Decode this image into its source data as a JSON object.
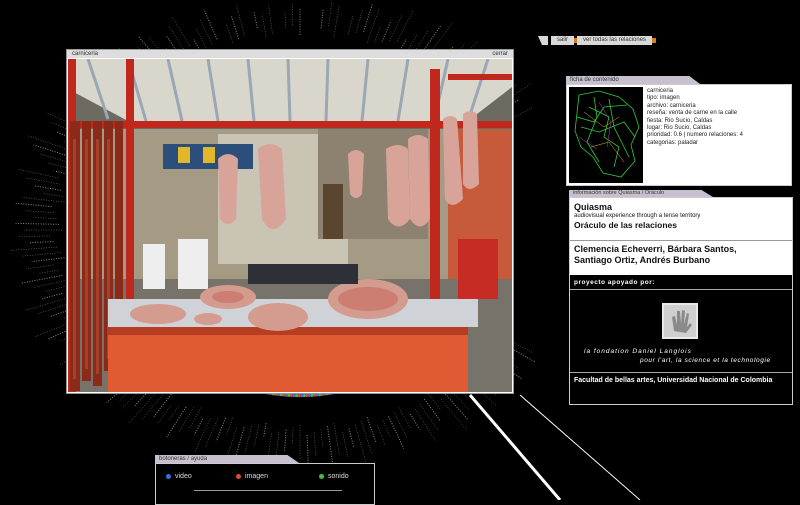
{
  "nav": {
    "salir": "salir",
    "ver_todas": "ver todas las relaciones"
  },
  "image_window": {
    "title": "carniceria",
    "close": "cerrar"
  },
  "ficha": {
    "tab": "ficha de contenido",
    "lines": [
      "carniceria",
      "tipo: imagen",
      "archivo: carniceria",
      "reseña: venta de carne en la calle",
      "fiesta: Rio Sucio, Caldas",
      "lugar: Rio Sucio, Caldas",
      "prioridad: 0.6  |  numero relaciones: 4",
      "categorias: paladar"
    ]
  },
  "info": {
    "tab": "información sobre Quiasma / Oráculo",
    "title": "Quiasma",
    "subtitle": "audiovisual experience through a tense territory",
    "oraculo": "Oráculo de las relaciones",
    "authors": "Clemencia Echeverri, Bárbara Santos, Santiago Ortiz, Andrés Burbano",
    "apoyo": "proyecto apoyado por:",
    "fondation_1": "la fondation Daniel Langlois",
    "fondation_2": "pour l'art, la science et la technologie",
    "facultad": "Facultad de bellas artes, Universidad Nacional de Colombia"
  },
  "controls": {
    "tab": "botoneras / ayuda",
    "legend": [
      {
        "label": "video",
        "color": "#3a6ee8"
      },
      {
        "label": "imagen",
        "color": "#e0482a"
      },
      {
        "label": "sonido",
        "color": "#3ec23e"
      }
    ]
  },
  "colors": {
    "panel_tab": "#c8c0cf",
    "accent": "#e07b1a"
  }
}
